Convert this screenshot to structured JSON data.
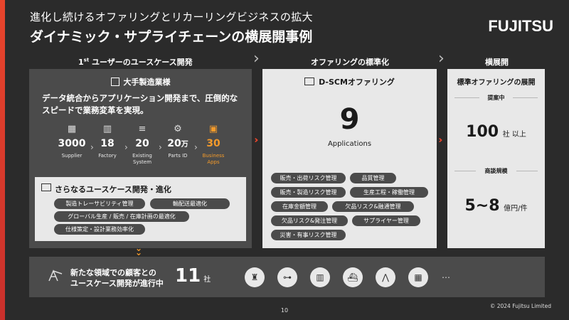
{
  "header": {
    "title1": "進化し続けるオファリングとリカーリングビジネスの拡大",
    "title2": "ダイナミック・サプライチェーンの横展開事例",
    "logo": "FUJITSU"
  },
  "columns": {
    "col1_prefix": "1",
    "col1_sup": "st",
    "col1_rest": " ユーザーのユースケース開発",
    "col2": "オファリングの標準化",
    "col3": "横展開"
  },
  "panel1": {
    "heading": "大手製造業様",
    "lead_line1": "データ統合からアプリケーション開発まで、圧倒的な",
    "lead_line2": "スピードで業務変革を実現。",
    "stats": [
      {
        "num": "3000",
        "unit": "",
        "label": "Supplier",
        "icon": "building-icon"
      },
      {
        "num": "18",
        "unit": "",
        "label": "Factory",
        "icon": "factory-icon"
      },
      {
        "num": "20",
        "unit": "",
        "label": "Existing System",
        "icon": "database-icon"
      },
      {
        "num": "20",
        "unit": "万",
        "label": "Parts ID",
        "icon": "gears-icon"
      },
      {
        "num": "30",
        "unit": "",
        "label": "Business Apps",
        "icon": "app-icon"
      }
    ],
    "sub": {
      "title": "さらなるユースケース開発・進化",
      "pills": [
        "製造トレーサビリティ管理",
        "輸配送最適化",
        "グローバル生産 / 販売 / 在庫計画の最適化",
        "仕様策定・設計業務効率化"
      ]
    }
  },
  "panel2": {
    "heading": "D-SCMオファリング",
    "big_num": "9",
    "big_label": "Applications",
    "pills": [
      "販売・出荷リスク管理",
      "品質管理",
      "販売・製造リスク管理",
      "生産工程・稼働管理",
      "在庫金額管理",
      "欠品リスク&融通管理",
      "欠品リスク&発注管理",
      "サプライヤー管理",
      "災害・有事リスク管理"
    ]
  },
  "panel3": {
    "heading": "標準オファリングの展開",
    "sub1": "提案中",
    "val1": "100",
    "unit1": "社 以上",
    "sub2": "商談規模",
    "val2": "5~8",
    "unit2": "億円/件"
  },
  "bottom": {
    "line1": "新たな領域での顧客との",
    "line2": "ユースケース開発が進行中",
    "num": "11",
    "unit": "社",
    "icons": [
      "plant-icon",
      "car-icon",
      "factory-icon",
      "ship-icon",
      "tower-icon",
      "building-icon"
    ],
    "more": "…"
  },
  "footer": {
    "page": "10",
    "copyright": "© 2024 Fujitsu Limited"
  },
  "colors": {
    "accent": "#e8452c",
    "orange": "#f39a2b",
    "panel_dark": "#4b4b4b",
    "panel_light": "#e8e8e8"
  }
}
